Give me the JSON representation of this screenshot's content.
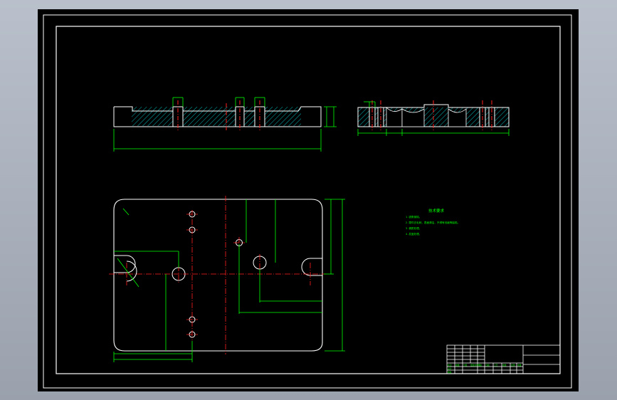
{
  "viewport": {
    "background": "#000000"
  },
  "colors": {
    "outline": "#ffffff",
    "dimension": "#00ff00",
    "centerline": "#ff2020",
    "hatch": "#00c8c8",
    "notes": "#00ff00"
  },
  "technical_requirements": {
    "heading": "技术要求",
    "lines": [
      "1.锐角倒钝。",
      "2.零件去毛刺，表面清洁，不得有划痕等缺陷。",
      "3.调质处理。",
      "4.发蓝处理。"
    ]
  },
  "title_block": {
    "cells": [
      "标记",
      "处数",
      "分区",
      "更改文件号",
      "签名",
      "日期",
      "设计",
      "审核",
      "工艺",
      "批准",
      "比例",
      "重量"
    ]
  },
  "dimensions": {
    "front_overall": "",
    "front_height": "",
    "side_overall": "",
    "plan_width": "",
    "plan_height": ""
  }
}
